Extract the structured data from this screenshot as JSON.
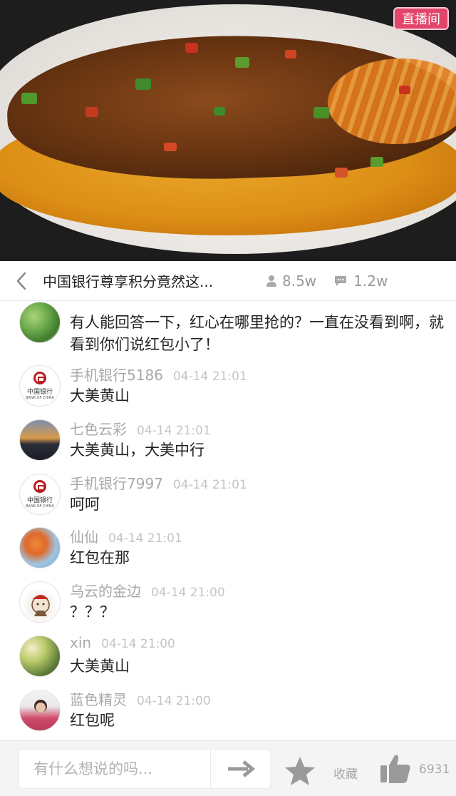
{
  "video": {
    "live_badge": "直播间"
  },
  "info_bar": {
    "title": "中国银行尊享积分竟然这...",
    "viewers": "8.5w",
    "comments_count": "1.2w"
  },
  "comments": [
    {
      "user": "",
      "time": "",
      "text": "有人能回答一下，红心在哪里抢的？一直在没看到啊，就看到你们说红包小了！",
      "avatar": "green-fruit"
    },
    {
      "user": "手机银行5186",
      "time": "04-14 21:01",
      "text": "大美黄山",
      "avatar": "bank-of-china-logo",
      "avatar_text_cn": "中国银行",
      "avatar_text_en": "BANK OF CHINA"
    },
    {
      "user": "七色云彩",
      "time": "04-14 21:01",
      "text": "大美黄山，大美中行",
      "avatar": "night-landscape"
    },
    {
      "user": "手机银行7997",
      "time": "04-14 21:01",
      "text": "呵呵",
      "avatar": "bank-of-china-logo",
      "avatar_text_cn": "中国银行",
      "avatar_text_en": "BANK OF CHINA"
    },
    {
      "user": "仙仙",
      "time": "04-14 21:01",
      "text": "红包在那",
      "avatar": "orange-flowers"
    },
    {
      "user": "乌云的金边",
      "time": "04-14 21:00",
      "text": "？？？",
      "avatar": "cartoon-character"
    },
    {
      "user": "xin",
      "time": "04-14 21:00",
      "text": "大美黄山",
      "avatar": "sunlit-trees"
    },
    {
      "user": "蓝色精灵",
      "time": "04-14 21:00",
      "text": "红包呢",
      "avatar": "person-photo"
    }
  ],
  "bottom_bar": {
    "input_placeholder": "有什么想说的吗...",
    "favorite_label": "收藏",
    "like_count": "6931"
  },
  "colors": {
    "live_badge": "#e1466a",
    "meta_text": "#a8a8a8",
    "icon_gray": "#9a9a9a",
    "boc_red": "#b81c22"
  }
}
